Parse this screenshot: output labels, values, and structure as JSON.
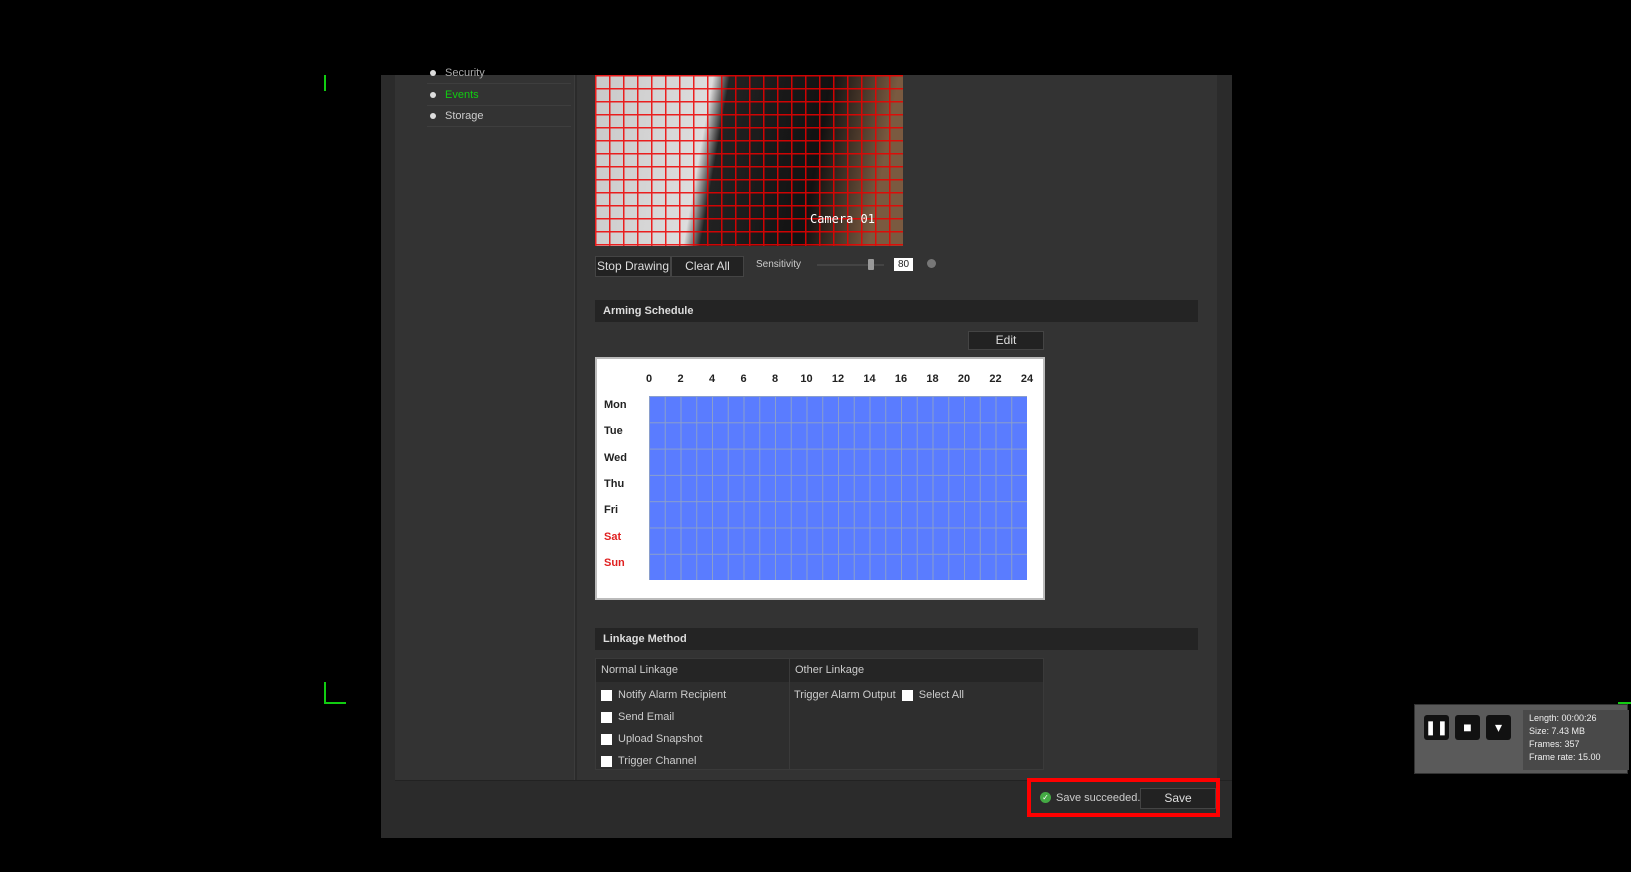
{
  "nav": {
    "items": [
      {
        "label": "Security"
      },
      {
        "label": "Events",
        "active": true
      },
      {
        "label": "Storage"
      }
    ]
  },
  "video": {
    "overlay": "Camera 01"
  },
  "drawing": {
    "stop_label": "Stop Drawing",
    "clear_label": "Clear All",
    "sensitivity_label": "Sensitivity",
    "sensitivity_value": "80",
    "sensitivity_fraction": 0.8
  },
  "arming": {
    "title": "Arming Schedule",
    "edit_label": "Edit",
    "hours": [
      "0",
      "2",
      "4",
      "6",
      "8",
      "10",
      "12",
      "14",
      "16",
      "18",
      "20",
      "22",
      "24"
    ],
    "days": [
      "Mon",
      "Tue",
      "Wed",
      "Thu",
      "Fri",
      "Sat",
      "Sun"
    ],
    "weekend_color": "#e02020",
    "schedule_color": "#5a7cff"
  },
  "linkage": {
    "title": "Linkage Method",
    "normal_header": "Normal Linkage",
    "other_header": "Other Linkage",
    "normal_items": [
      "Notify Alarm Recipient",
      "Send Email",
      "Upload Snapshot",
      "Trigger Channel"
    ],
    "trigger_alarm_output": "Trigger Alarm Output",
    "select_all": "Select All"
  },
  "footer": {
    "status": "Save succeeded.",
    "save_label": "Save"
  },
  "recorder": {
    "length": "Length: 00:00:26",
    "size": "Size: 7.43 MB",
    "frames": "Frames: 357",
    "frame_rate": "Frame rate: 15.00"
  }
}
